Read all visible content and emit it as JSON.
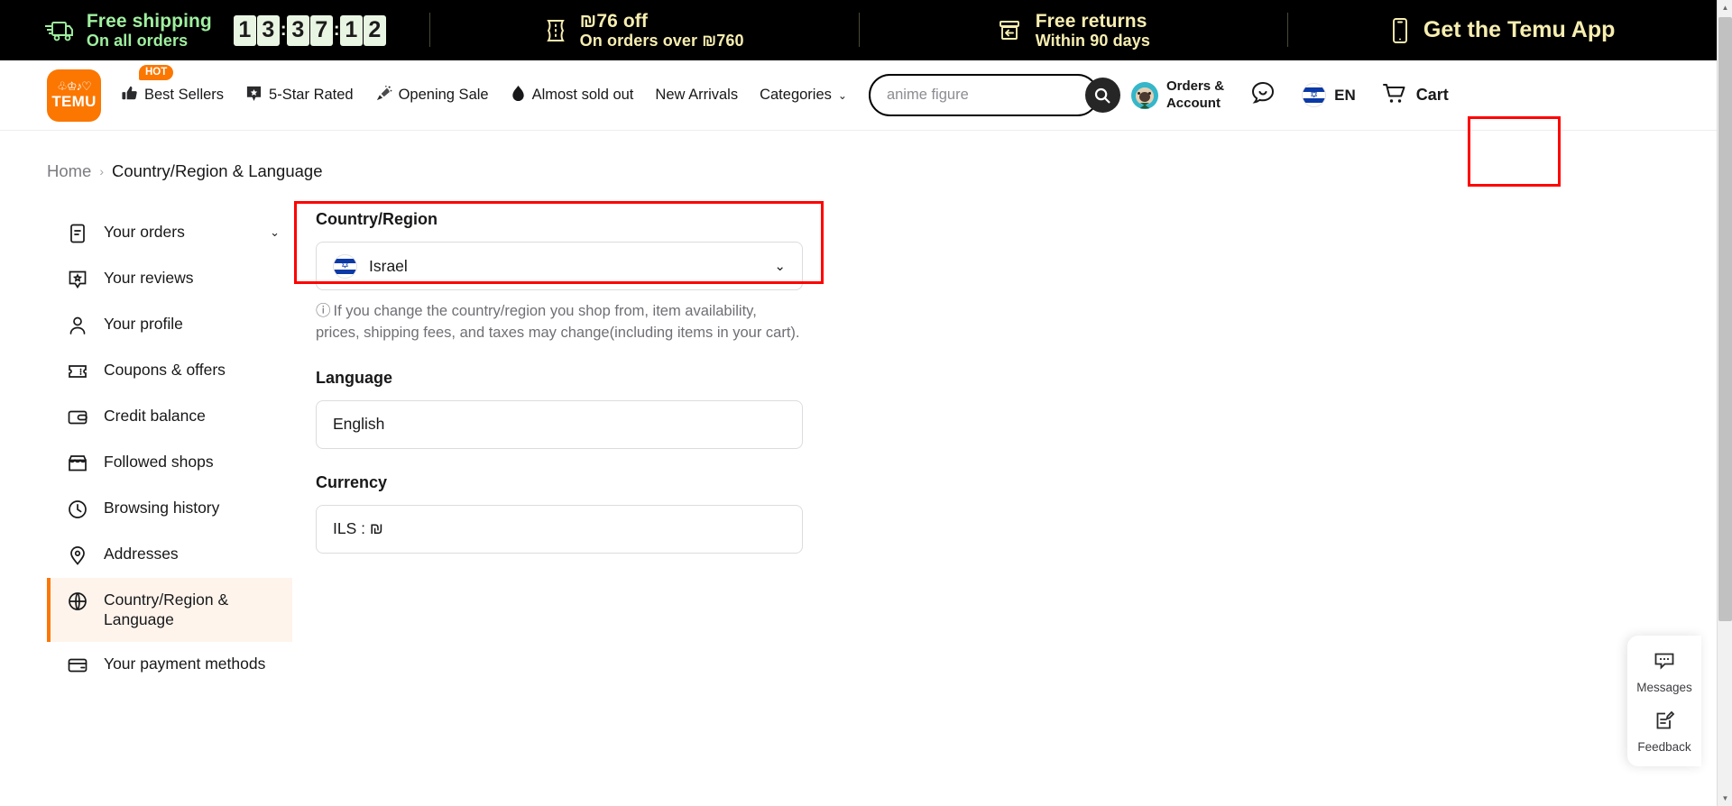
{
  "promo_bar": {
    "items": [
      {
        "icon": "truck-icon",
        "line1": "Free shipping",
        "line2": "On all orders",
        "color": "#9ff09f",
        "countdown": "13:37:12"
      },
      {
        "icon": "coupon-icon",
        "line1": "₪76 off",
        "line2": "On orders over ₪760",
        "color": "#f7eeb0"
      },
      {
        "icon": "return-box-icon",
        "line1": "Free returns",
        "line2": "Within 90 days",
        "color": "#f7eeb0"
      },
      {
        "icon": "mobile-phone-icon",
        "line1": "Get the Temu App",
        "line2": "",
        "color": "#f7eeb0"
      }
    ],
    "countdown_digits": [
      "1",
      "3",
      "3",
      "7",
      "1",
      "2"
    ],
    "countdown_separator": ":"
  },
  "nav": {
    "logo": {
      "glyph": "♧♔♪♡",
      "word": "TEMU",
      "color": "#fb7701"
    },
    "links": [
      {
        "label": "Best Sellers",
        "icon": "thumbs-up-icon",
        "badge": "HOT"
      },
      {
        "label": "5-Star Rated",
        "icon": "star-badge-icon",
        "badge": ""
      },
      {
        "label": "Opening Sale",
        "icon": "party-popper-icon",
        "badge": ""
      },
      {
        "label": "Almost sold out",
        "icon": "flame-drop-icon",
        "badge": ""
      },
      {
        "label": "New Arrivals",
        "icon": "",
        "badge": ""
      },
      {
        "label": "Categories",
        "icon": "",
        "badge": "",
        "chevron": "⌄"
      }
    ],
    "search": {
      "placeholder": "anime figure",
      "value": "",
      "button_icon": "search-icon"
    },
    "right": {
      "account": {
        "line1": "Orders &",
        "line2": "Account",
        "icon": "user-avatar-pug"
      },
      "support_icon": "smile-chat-icon",
      "language": {
        "label": "EN",
        "icon": "israel-flag-icon",
        "highlighted": true
      },
      "cart": {
        "label": "Cart",
        "icon": "shopping-cart-icon"
      }
    },
    "highlight_color": "#ff0000"
  },
  "breadcrumb": {
    "home": "Home",
    "separator": "›",
    "current": "Country/Region & Language"
  },
  "sidebar": {
    "items": [
      {
        "label": "Your orders",
        "icon": "order-list-icon",
        "chevron": "⌄",
        "active": false
      },
      {
        "label": "Your reviews",
        "icon": "review-star-icon",
        "active": false
      },
      {
        "label": "Your profile",
        "icon": "person-icon",
        "active": false
      },
      {
        "label": "Coupons & offers",
        "icon": "coupon-ticket-icon",
        "active": false
      },
      {
        "label": "Credit balance",
        "icon": "wallet-icon",
        "active": false
      },
      {
        "label": "Followed shops",
        "icon": "store-icon",
        "active": false
      },
      {
        "label": "Browsing history",
        "icon": "clock-icon",
        "active": false
      },
      {
        "label": "Addresses",
        "icon": "map-pin-icon",
        "active": false
      },
      {
        "label": "Country/Region & Language",
        "icon": "globe-icon",
        "active": true
      },
      {
        "label": "Your payment methods",
        "icon": "credit-card-icon",
        "active": false
      }
    ],
    "active_accent": "#fb7701",
    "active_background": "#fef4ec"
  },
  "main": {
    "country": {
      "label": "Country/Region",
      "value": "Israel",
      "flag_icon": "israel-flag-icon",
      "chevron": "⌄",
      "highlighted": true,
      "hint": "If you change the country/region you shop from, item availability, prices, shipping fees, and taxes may change(including items in your cart).",
      "hint_icon": "info-circle-icon"
    },
    "language": {
      "label": "Language",
      "value": "English"
    },
    "currency": {
      "label": "Currency",
      "value": "ILS : ₪"
    }
  },
  "float_widget": {
    "items": [
      {
        "label": "Messages",
        "icon": "chat-bubble-dots-icon"
      },
      {
        "label": "Feedback",
        "icon": "feedback-pencil-icon"
      }
    ]
  },
  "scrollbar": {
    "up_arrow": "▲",
    "down_arrow": "▼"
  }
}
